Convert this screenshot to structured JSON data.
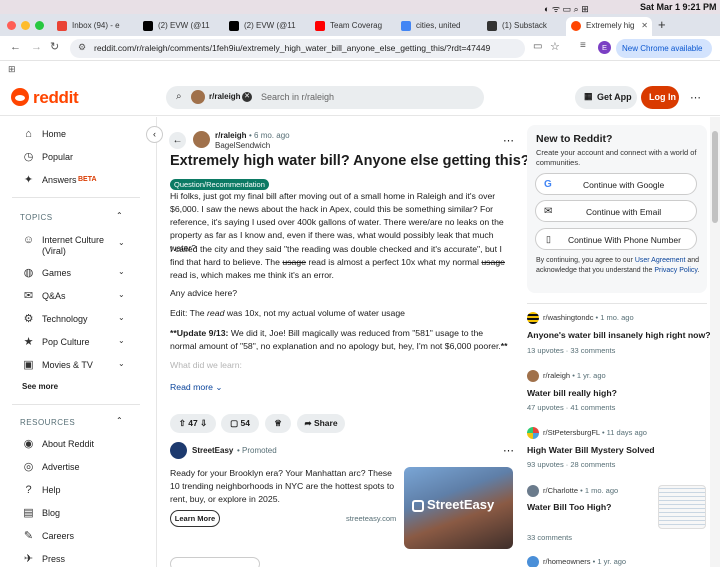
{
  "menubar": {
    "time": "Sat Mar 1  9:21 PM"
  },
  "tabs": [
    {
      "label": "Inbox (94) - e",
      "color": "#ea4335"
    },
    {
      "label": "(2) EVW (@11",
      "color": "#000000"
    },
    {
      "label": "(2) EVW (@11",
      "color": "#000000"
    },
    {
      "label": "Team Coverag",
      "color": "#ff0000"
    },
    {
      "label": "cities, united",
      "color": "#4285f4"
    },
    {
      "label": "(1) Substack",
      "color": "#333333"
    },
    {
      "label": "Extremely hig",
      "color": "#ff4500"
    }
  ],
  "address": {
    "url": "reddit.com/r/raleigh/comments/1feh9iu/extremely_high_water_bill_anyone_else_getting_this/?rdt=47449",
    "profile_initial": "E",
    "chrome_update": "New Chrome available"
  },
  "header": {
    "logo_text": "reddit",
    "search_community": "r/raleigh",
    "search_placeholder": "Search in r/raleigh",
    "get_app": "Get App",
    "login": "Log In"
  },
  "nav": {
    "home": "Home",
    "popular": "Popular",
    "answers": "Answers",
    "answers_badge": "BETA",
    "topics_header": "TOPICS",
    "topics": [
      "Internet Culture (Viral)",
      "Games",
      "Q&As",
      "Technology",
      "Pop Culture",
      "Movies & TV"
    ],
    "see_more": "See more",
    "resources_header": "RESOURCES",
    "resources": [
      "About Reddit",
      "Advertise",
      "Help",
      "Blog",
      "Careers",
      "Press"
    ]
  },
  "post": {
    "subreddit": "r/raleigh",
    "age": "• 6 mo. ago",
    "author": "BagelSendwich",
    "title": "Extremely high water bill? Anyone else getting this?",
    "flair": "Question/Recommendation",
    "para1": "Hi folks, just got my final bill after moving out of a small home in Raleigh and it's over $6,000. I saw the news about the hack in Apex, could this be something similar? For reference, it's saying I used over 400k gallons of water. There were/are no leaks on the property as far as I know and, even if there was, what would possibly leak that much water?",
    "para2_a": "I called the city and they said \"the reading was double checked and it's accurate\", but I find that hard to believe. The ",
    "para2_strike1": "usage",
    "para2_b": " read is almost a perfect 10x what my normal ",
    "para2_strike2": "usage",
    "para2_c": " read is, which makes me think it's an error.",
    "para3": "Any advice here?",
    "para4_a": "Edit: The ",
    "para4_em": "read",
    "para4_b": " was 10x, not my actual volume of water usage",
    "update_bold": "**Update 9/13:",
    "update_text": " We did it, Joe! Bill magically was reduced from \"581\" usage to the normal amount of \"58\", no explanation and no apology but, hey, I'm not $6,000 poorer.",
    "update_end": "**",
    "faded": "What did we learn:",
    "read_more": "Read more",
    "votes": "47",
    "comments": "54",
    "share": "Share"
  },
  "promo": {
    "name": "StreetEasy",
    "tag": "• Promoted",
    "text": "Ready for your Brooklyn era? Your Manhattan arc? These 10 trending neighborhoods in NYC are the hottest spots to rent, buy, or explore in 2025.",
    "cta": "Learn More",
    "domain": "streeteasy.com",
    "image_text": "StreetEasy"
  },
  "rail": {
    "heading": "New to Reddit?",
    "sub": "Create your account and connect with a world of communities.",
    "google": "Continue with Google",
    "email": "Continue with Email",
    "phone": "Continue With Phone Number",
    "legal_a": "By continuing, you agree to our ",
    "legal_link1": "User Agreement",
    "legal_b": " and acknowledge that you understand the ",
    "legal_link2": "Privacy Policy",
    "legal_c": ".",
    "related": [
      {
        "sub": "r/washingtondc",
        "age": "• 1 mo. ago",
        "title": "Anyone's water bill insanely high right now?",
        "upvotes": "13 upvotes",
        "comments": "33 comments"
      },
      {
        "sub": "r/raleigh",
        "age": "• 1 yr. ago",
        "title": "Water bill really high?",
        "upvotes": "47 upvotes",
        "comments": "41 comments"
      },
      {
        "sub": "r/StPetersburgFL",
        "age": "• 11 days ago",
        "title": "High Water Bill Mystery Solved",
        "upvotes": "93 upvotes",
        "comments": "28 comments"
      },
      {
        "sub": "r/Charlotte",
        "age": "• 1 mo. ago",
        "title": "Water Bill Too High?",
        "upvotes": "",
        "comments": "33 comments"
      },
      {
        "sub": "r/homeowners",
        "age": "• 1 yr. ago"
      }
    ]
  }
}
